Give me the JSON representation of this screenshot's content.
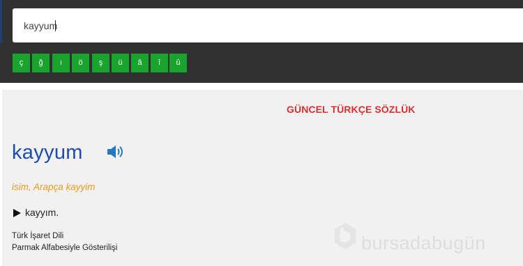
{
  "search": {
    "value": "kayyum"
  },
  "special_characters": [
    "ç",
    "ğ",
    "ı",
    "ö",
    "ş",
    "ü",
    "â",
    "î",
    "û"
  ],
  "dictionary": {
    "title": "GÜNCEL TÜRKÇE SÖZLÜK",
    "headword": "kayyum",
    "grammar": "isim, Arapça ḳayyim",
    "meaning": "kayyım.",
    "sign_language_line_1": "Türk İşaret Dili",
    "sign_language_line_2": "Parmak Alfabesiyle Gösterilişi"
  },
  "watermark": {
    "text": "bursadabugün"
  },
  "icons": {
    "audio": "speaker-icon",
    "meaning_marker": "right-triangle-icon",
    "watermark": "watermark-logo-icon"
  },
  "colors": {
    "top_panel": "#303130",
    "button_green": "#19a52d",
    "content_background": "#f1f1f1",
    "title_red": "#d72f2f",
    "headword_blue": "#1e4cab",
    "grammar_orange": "#e89b23",
    "speaker_blue": "#2479bd"
  }
}
